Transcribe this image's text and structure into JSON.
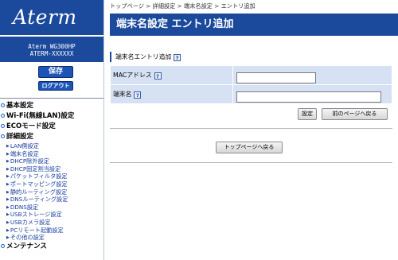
{
  "sidebar": {
    "logo": "Aterm",
    "model": "Aterm WG300HP",
    "device_name": "ATERM-XXXXXX",
    "save_label": "保存",
    "logout_label": "ログアウト",
    "menu": {
      "basic": "基本設定",
      "wifi": "Wi-Fi(無線LAN)設定",
      "eco": "ECOモード設定",
      "advanced": "詳細設定",
      "advanced_items": [
        "LAN側設定",
        "端末名設定",
        "DHCP除外設定",
        "DHCP固定割当設定",
        "パケットフィルタ設定",
        "ポートマッピング設定",
        "静的ルーティング設定",
        "DNSルーティング設定",
        "DDNS設定",
        "USBストレージ設定",
        "USBカメラ設定",
        "PCリモート起動設定",
        "その他の設定"
      ],
      "maintenance": "メンテナンス"
    }
  },
  "breadcrumb": {
    "top": "トップページ",
    "sep": ">",
    "advanced": "詳細設定",
    "terminal": "端末名設定",
    "current": "エントリ追加"
  },
  "page": {
    "title": "端末名設定 エントリ追加",
    "section": "端末名エントリ追加",
    "help_mark": "?",
    "fields": [
      {
        "label": "MACアドレス",
        "value": ""
      },
      {
        "label": "端末名",
        "value": ""
      }
    ],
    "set_button": "設定",
    "prev_button": "前のページへ戻る",
    "top_button": "トップページへ戻る"
  },
  "colors": {
    "brand": "#1b4a9c",
    "form_bg": "#d6e1f3",
    "link": "#1a3f9c"
  }
}
